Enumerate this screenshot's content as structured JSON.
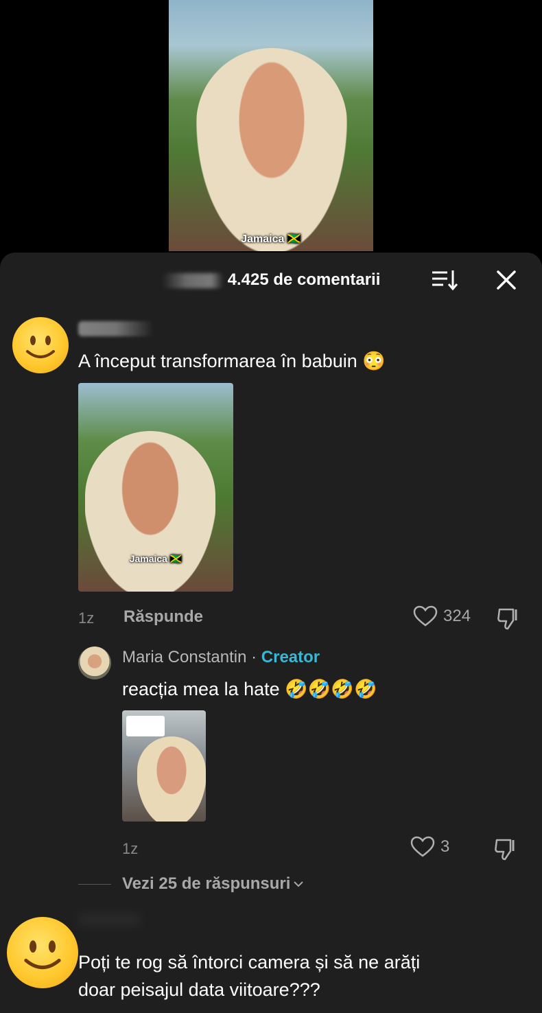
{
  "video": {
    "caption": "Jamaica 🇯🇲"
  },
  "sheet": {
    "comment_count": "4.425 de comentarii"
  },
  "comments": [
    {
      "text": "A început transformarea în babuin 😳",
      "thumb_caption": "Jamaica 🇯🇲",
      "age": "1z",
      "reply_label": "Răspunde",
      "likes": "324"
    },
    {
      "text_line1": "Poți te rog să întorci camera și să ne arăți",
      "text_line2": "doar peisajul data viitoare???"
    }
  ],
  "reply": {
    "author": "Maria Constantin",
    "separator": "·",
    "tag": "Creator",
    "text": "reacția mea la hate 🤣🤣🤣🤣",
    "age": "1z",
    "likes": "3"
  },
  "view_replies": {
    "label": "Vezi 25 de răspunsuri"
  },
  "colors": {
    "accent_creator": "#39b8d4",
    "sheet_bg": "#1f1f1f"
  }
}
